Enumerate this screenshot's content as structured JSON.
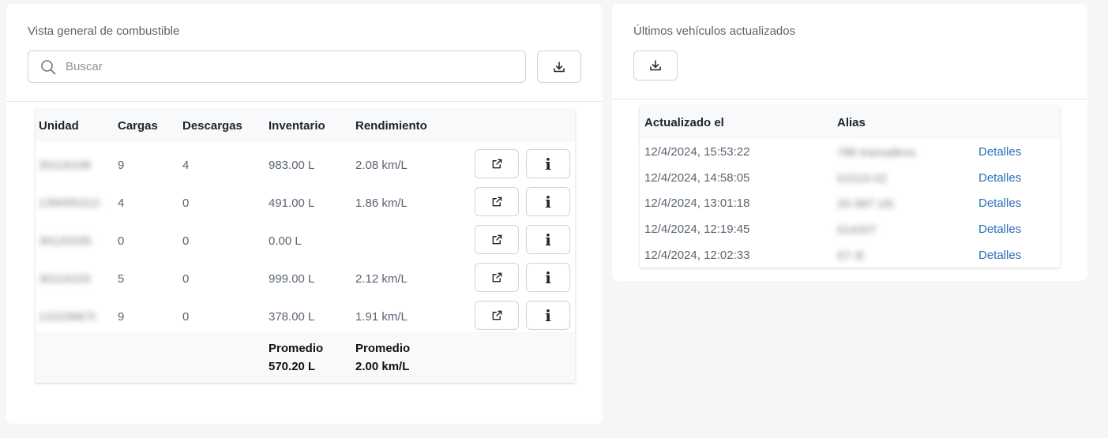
{
  "fuel_overview": {
    "title": "Vista general de combustible",
    "search_placeholder": "Buscar",
    "columns": [
      "Unidad",
      "Cargas",
      "Descargas",
      "Inventario",
      "Rendimiento"
    ],
    "rows": [
      {
        "unit": "30116108",
        "cargas": "9",
        "descargas": "4",
        "inventario": "983.00 L",
        "rendimiento": "2.08 km/L"
      },
      {
        "unit": "1390053123",
        "cargas": "4",
        "descargas": "0",
        "inventario": "491.00 L",
        "rendimiento": "1.86 km/L"
      },
      {
        "unit": "30120335",
        "cargas": "0",
        "descargas": "0",
        "inventario": "0.00 L",
        "rendimiento": ""
      },
      {
        "unit": "30116103",
        "cargas": "5",
        "descargas": "0",
        "inventario": "999.00 L",
        "rendimiento": "2.12 km/L"
      },
      {
        "unit": "1310366784",
        "cargas": "9",
        "descargas": "0",
        "inventario": "378.00 L",
        "rendimiento": "1.91 km/L"
      }
    ],
    "footer": {
      "inventario_label": "Promedio",
      "inventario_value": "570.20 L",
      "rendimiento_label": "Promedio",
      "rendimiento_value": "2.00 km/L"
    }
  },
  "latest_vehicles": {
    "title": "Últimos vehículos actualizados",
    "columns": [
      "Actualizado el",
      "Alias"
    ],
    "rows": [
      {
        "updated": "12/4/2024, 15:53:22",
        "alias": "786 transaltros",
        "link": "Detalles"
      },
      {
        "updated": "12/4/2024, 14:58:05",
        "alias": "01515-02",
        "link": "Detalles"
      },
      {
        "updated": "12/4/2024, 13:01:18",
        "alias": "20-387-182",
        "link": "Detalles"
      },
      {
        "updated": "12/4/2024, 12:19:45",
        "alias": "014207",
        "link": "Detalles"
      },
      {
        "updated": "12/4/2024, 12:02:33",
        "alias": "57-35",
        "link": "Detalles"
      }
    ]
  },
  "icons": {
    "search": "search-icon",
    "download": "download-icon",
    "external_link": "external-link-icon",
    "info": "info-icon"
  },
  "colors": {
    "page_bg": "#f5f6f8",
    "card_bg": "#ffffff",
    "table_header_bg": "#f8f9fa",
    "link": "#2a6ebb",
    "muted_text": "#5a6470"
  }
}
